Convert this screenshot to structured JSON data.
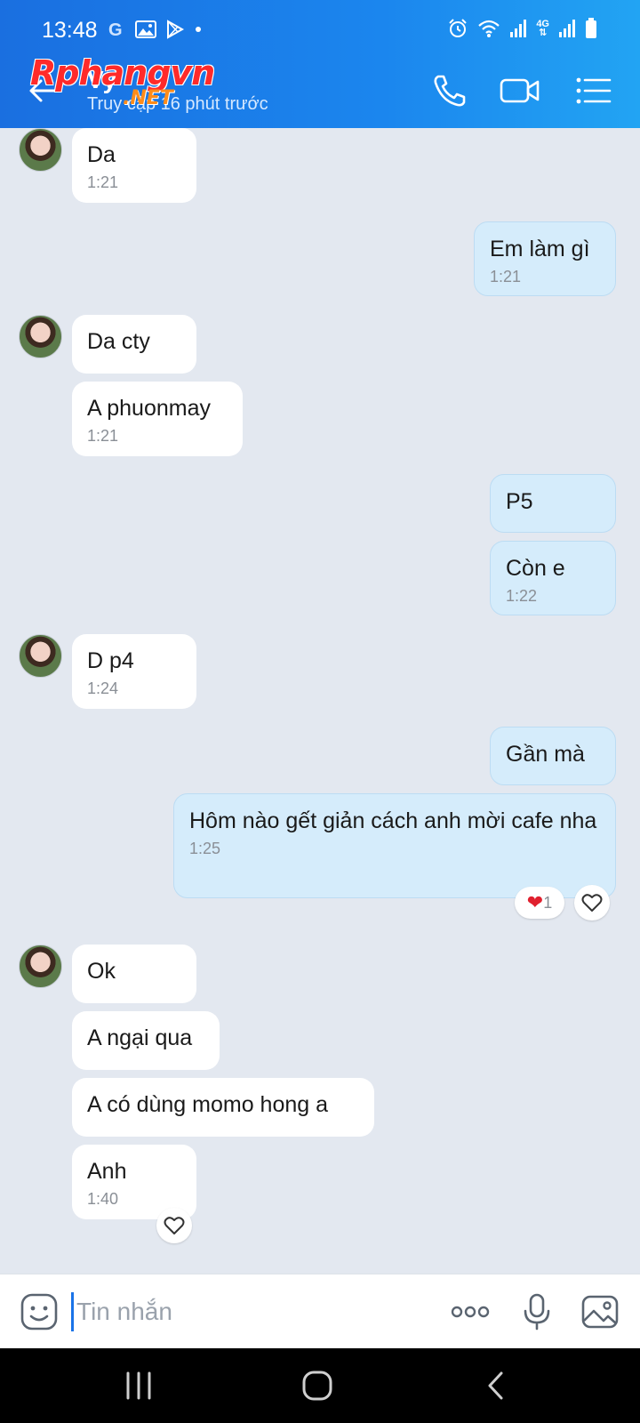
{
  "status_bar": {
    "time": "13:48",
    "network": "4G"
  },
  "header": {
    "contact_name": "Vy",
    "last_seen": "Truy cập 16 phút trước",
    "watermark_main": "Rphangvn",
    "watermark_sub": ".NET"
  },
  "messages": [
    {
      "dir": "in",
      "text": "Da",
      "time": "1:21"
    },
    {
      "dir": "out",
      "text": "Em làm gì",
      "time": "1:21"
    },
    {
      "dir": "in",
      "text": "Da cty",
      "time": ""
    },
    {
      "dir": "in",
      "text": "A phuonmay",
      "time": "1:21"
    },
    {
      "dir": "out",
      "text": "P5",
      "time": ""
    },
    {
      "dir": "out",
      "text": "Còn e",
      "time": "1:22"
    },
    {
      "dir": "in",
      "text": "D p4",
      "time": "1:24"
    },
    {
      "dir": "out",
      "text": "Gần mà",
      "time": ""
    },
    {
      "dir": "out",
      "text": "Hôm nào gết giản cách anh mời cafe nha",
      "time": "1:25"
    },
    {
      "dir": "in",
      "text": " Ok",
      "time": ""
    },
    {
      "dir": "in",
      "text": "A ngại qua",
      "time": ""
    },
    {
      "dir": "in",
      "text": "A có dùng momo hong a",
      "time": ""
    },
    {
      "dir": "in",
      "text": "Anh",
      "time": "1:40"
    }
  ],
  "reactions": {
    "cafe_message_count": "1"
  },
  "input": {
    "placeholder": "Tin nhắn"
  },
  "colors": {
    "header_start": "#1a6fe0",
    "header_end": "#22a4f3",
    "chat_bg": "#e3e8f0",
    "incoming_bubble": "#ffffff",
    "outgoing_bubble": "#d5ecfb",
    "heart": "#e0202e"
  }
}
